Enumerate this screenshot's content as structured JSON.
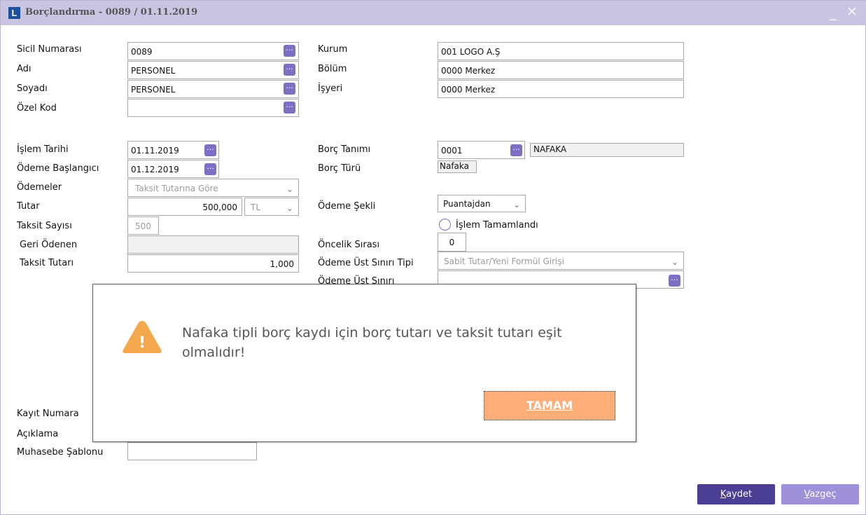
{
  "window": {
    "title": "Borçlandırma - 0089 / 01.11.2019",
    "logo": "L",
    "minimize_icon": "_",
    "close_icon": "✕"
  },
  "form": {
    "sicil_label": "Sicil Numarası",
    "sicil_value": "0089",
    "adi_label": "Adı",
    "adi_value": "PERSONEL",
    "soyadi_label": "Soyadı",
    "soyadi_value": "PERSONEL",
    "ozel_kod_label": "Özel Kod",
    "ozel_kod_value": "",
    "kurum_label": "Kurum",
    "kurum_value": "001 LOGO A.Ş",
    "bolum_label": "Bölüm",
    "bolum_value": "0000 Merkez",
    "isyeri_label": "İşyeri",
    "isyeri_value": "0000 Merkez",
    "islem_tarihi_label": "İşlem Tarihi",
    "islem_tarihi_value": "01.11.2019",
    "odeme_baslangici_label": "Ödeme Başlangıcı",
    "odeme_baslangici_value": "01.12.2019",
    "odemeler_label": "Ödemeler",
    "odemeler_value": "Taksit Tutarına Göre",
    "tutar_label": "Tutar",
    "tutar_value": "500,000",
    "currency_value": "TL",
    "taksit_sayisi_label": "Taksit Sayısı",
    "taksit_sayisi_value": "500",
    "geri_odenen_label": "Geri Ödenen",
    "geri_odenen_value": "",
    "taksit_tutari_label": "Taksit Tutarı",
    "taksit_tutari_value": "1,000",
    "borc_tanimi_label": "Borç Tanımı",
    "borc_tanimi_code": "0001",
    "borc_tanimi_name": "NAFAKA",
    "borc_turu_label": "Borç Türü",
    "borc_turu_value": "Nafaka",
    "odeme_sekli_label": "Ödeme Şekli",
    "odeme_sekli_value": "Puantajdan",
    "islem_tamamlandi_label": "İşlem Tamamlandı",
    "oncelik_sirasi_label": "Öncelik Sırası",
    "oncelik_sirasi_value": "0",
    "odeme_ust_siniri_tipi_label": "Ödeme Üst Sınırı Tipi",
    "odeme_ust_siniri_tipi_value": "Sabit Tutar/Yeni Formül Girişi",
    "odeme_ust_siniri_label": "Ödeme Üst Sınırı",
    "odeme_ust_siniri_value": "",
    "kayit_numarasi_label": "Kayıt Numara",
    "aciklama_label": "Açıklama",
    "muhasebe_sablonu_label": "Muhasebe Şablonu",
    "muhasebe_sablonu_value": "",
    "lookup_icon": "...",
    "dropdown_icon": "⌄"
  },
  "buttons": {
    "save_label": "aydet",
    "save_mnemonic": "K",
    "cancel_label": "azgeç",
    "cancel_mnemonic": "V"
  },
  "dialog": {
    "message": "Nafaka tipli borç kaydı için borç tutarı ve taksit tutarı eşit olmalıdır!",
    "warning_icon": "!",
    "ok_label": "TAMAM"
  },
  "colors": {
    "titlebar": "#c9c4e2",
    "accent": "#7d6fc4",
    "save_button": "#4b3f95",
    "cancel_button": "#9e91d9",
    "warning": "#f5a94e",
    "dialog_button": "#fdae78"
  }
}
